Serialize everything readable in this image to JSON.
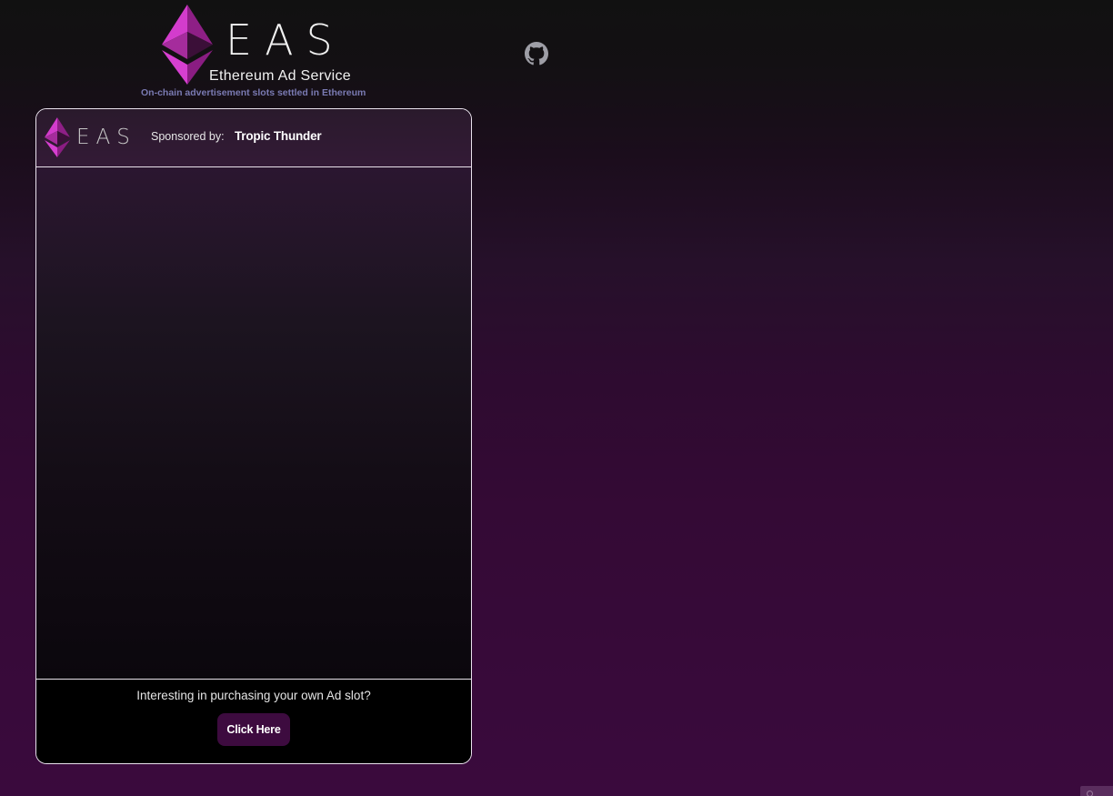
{
  "header": {
    "logo_letters": "EAS",
    "service_name": "Ethereum Ad Service",
    "tagline": "On-chain advertisement slots settled in Ethereum"
  },
  "icons": {
    "github": "github-icon",
    "ethereum": "ethereum-diamond-icon"
  },
  "ad": {
    "logo_letters": "EAS",
    "sponsored_label": "Sponsored by:",
    "sponsor_name": "Tropic Thunder",
    "footer_prompt": "Interesting in purchasing your own Ad slot?",
    "cta_label": "Click Here"
  },
  "colors": {
    "accent_magenta": "#c330b8",
    "button_bg": "#3d0b3f",
    "tagline": "#7a7ab2",
    "page_bottom": "#3a0a3d"
  }
}
